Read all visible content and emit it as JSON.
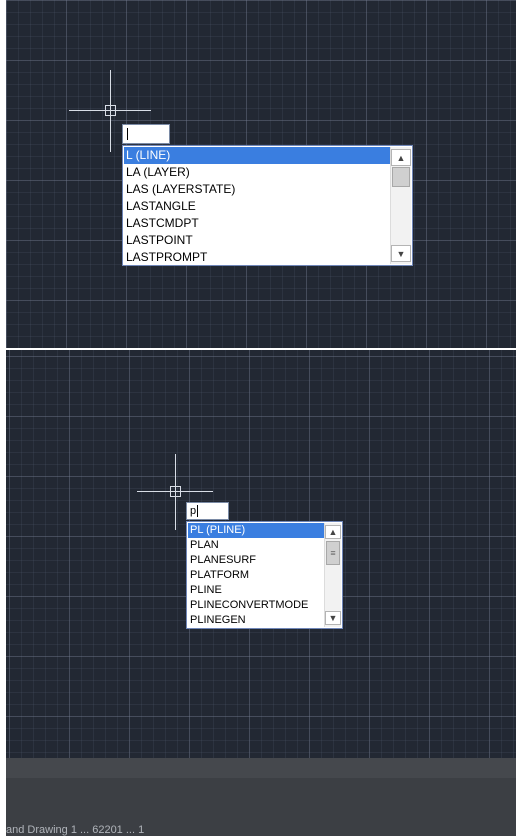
{
  "top_panel": {
    "input_value": "",
    "suggestions": [
      "L (LINE)",
      "LA (LAYER)",
      "LAS (LAYERSTATE)",
      "LASTANGLE",
      "LASTCMDPT",
      "LASTPOINT",
      "LASTPROMPT"
    ],
    "selected_index": 0
  },
  "bottom_panel": {
    "input_value": "p",
    "suggestions": [
      "PL (PLINE)",
      "PLAN",
      "PLANESURF",
      "PLATFORM",
      "PLINE",
      "PLINECONVERTMODE",
      "PLINEGEN"
    ],
    "selected_index": 0
  },
  "icons": {
    "scroll_up": "▲",
    "scroll_down": "▼",
    "grip": "≡"
  },
  "colors": {
    "canvas": "#222833",
    "selection": "#3a7ee0",
    "crosshair": "#d8dde6"
  },
  "status_text": "and Drawing 1 ... 62201 ... 1"
}
